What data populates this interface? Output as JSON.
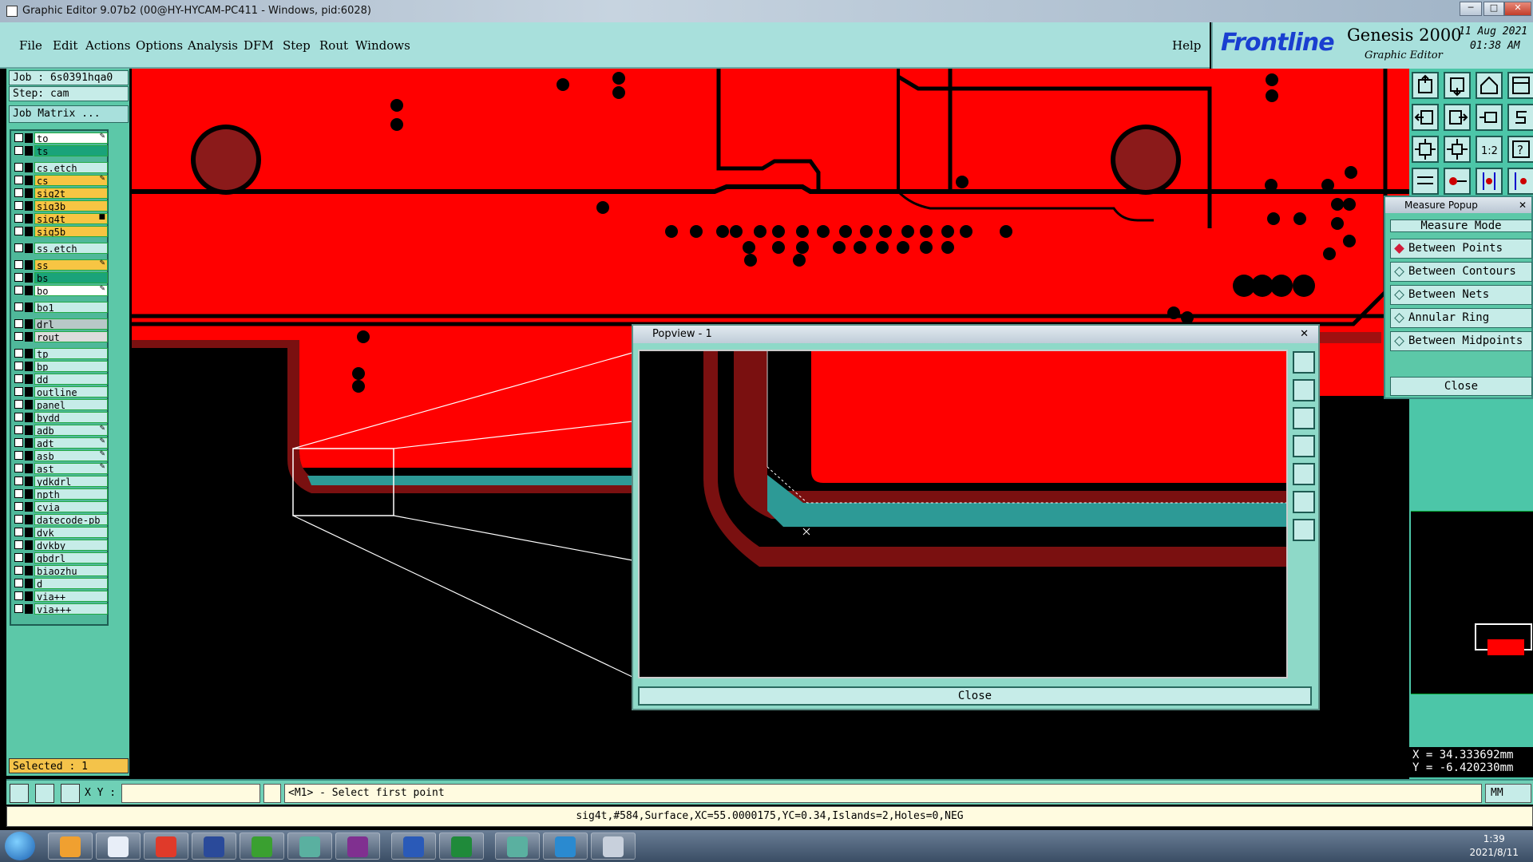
{
  "window": {
    "title": "Graphic Editor 9.07b2 (00@HY-HYCAM-PC411 - Windows, pid:6028)"
  },
  "menu": [
    "File",
    "Edit",
    "Actions",
    "Options",
    "Analysis",
    "DFM",
    "Step",
    "Rout",
    "Windows"
  ],
  "help_label": "Help",
  "logo": {
    "brand": "Frontline",
    "product": "Genesis 2000",
    "subtitle": "Graphic Editor",
    "date": "11 Aug 2021",
    "time": "01:38 AM"
  },
  "job": {
    "job_label": "Job  :  6s0391hqa0",
    "step_label": "Step:  cam",
    "matrix_button": "Job Matrix ..."
  },
  "layers": [
    {
      "name": "to",
      "color": "#ffffff",
      "mark": "✎"
    },
    {
      "name": "ts",
      "color": "#1aa37a",
      "mark": ""
    },
    {
      "name": "cs.etch",
      "color": "#c6ece8",
      "mark": ""
    },
    {
      "name": "cs",
      "color": "#f7c543",
      "mark": "✎"
    },
    {
      "name": "sig2t",
      "color": "#f7c543",
      "mark": ""
    },
    {
      "name": "sig3b",
      "color": "#f7c543",
      "mark": ""
    },
    {
      "name": "sig4t",
      "color": "#f7c543",
      "mark": "■"
    },
    {
      "name": "sig5b",
      "color": "#f7c543",
      "mark": ""
    },
    {
      "name": "ss.etch",
      "color": "#c6ece8",
      "mark": ""
    },
    {
      "name": "ss",
      "color": "#f7c543",
      "mark": "✎"
    },
    {
      "name": "bs",
      "color": "#1aa37a",
      "mark": ""
    },
    {
      "name": "bo",
      "color": "#ffffff",
      "mark": "✎"
    },
    {
      "name": "bo1",
      "color": "#c6ece8",
      "mark": ""
    },
    {
      "name": "drl",
      "color": "#b8c8c8",
      "mark": ""
    },
    {
      "name": "rout",
      "color": "#dcdcdc",
      "mark": ""
    },
    {
      "name": "tp",
      "color": "#c6ece8",
      "mark": ""
    },
    {
      "name": "bp",
      "color": "#c6ece8",
      "mark": ""
    },
    {
      "name": "dd",
      "color": "#c6ece8",
      "mark": ""
    },
    {
      "name": "outline",
      "color": "#c6ece8",
      "mark": ""
    },
    {
      "name": "panel",
      "color": "#c6ece8",
      "mark": ""
    },
    {
      "name": "bydd",
      "color": "#c6ece8",
      "mark": ""
    },
    {
      "name": "adb",
      "color": "#c6ece8",
      "mark": "✎"
    },
    {
      "name": "adt",
      "color": "#c6ece8",
      "mark": "✎"
    },
    {
      "name": "asb",
      "color": "#c6ece8",
      "mark": "✎"
    },
    {
      "name": "ast",
      "color": "#c6ece8",
      "mark": "✎"
    },
    {
      "name": "ydkdrl",
      "color": "#c6ece8",
      "mark": ""
    },
    {
      "name": "npth",
      "color": "#c6ece8",
      "mark": ""
    },
    {
      "name": "cvia",
      "color": "#c6ece8",
      "mark": ""
    },
    {
      "name": "datecode-pb",
      "color": "#c6ece8",
      "mark": ""
    },
    {
      "name": "dvk",
      "color": "#c6ece8",
      "mark": ""
    },
    {
      "name": "dvkby",
      "color": "#c6ece8",
      "mark": ""
    },
    {
      "name": "gbdrl",
      "color": "#c6ece8",
      "mark": ""
    },
    {
      "name": "biaozhu",
      "color": "#c6ece8",
      "mark": ""
    },
    {
      "name": "d",
      "color": "#c6ece8",
      "mark": ""
    },
    {
      "name": "via++",
      "color": "#c6ece8",
      "mark": ""
    },
    {
      "name": "via+++",
      "color": "#c6ece8",
      "mark": ""
    }
  ],
  "selected_label": "Selected : 1",
  "measure": {
    "title": "Measure Popup",
    "mode_label": "Measure Mode",
    "options": [
      "Between Points",
      "Between Contours",
      "Between Nets",
      "Annular Ring",
      "Between Midpoints"
    ],
    "active_index": 0,
    "close_label": "Close"
  },
  "popview": {
    "title": "Popview - 1",
    "close_label": "Close"
  },
  "coords": {
    "x": "X = 34.333692mm",
    "y": "Y = -6.420230mm"
  },
  "command": {
    "xy_label": "X Y :",
    "prompt": "<M1> - Select first point",
    "units": "MM"
  },
  "info": "sig4t,#584,Surface,XC=55.0000175,YC=0.34,Islands=2,Holes=0,NEG",
  "taskbar": {
    "time": "1:39",
    "date": "2021/8/11"
  },
  "colors": {
    "copper": "#ff0000",
    "dark_copper": "#7a1010",
    "highlight": "#2d9a96",
    "panel": "#5cc8a8"
  }
}
